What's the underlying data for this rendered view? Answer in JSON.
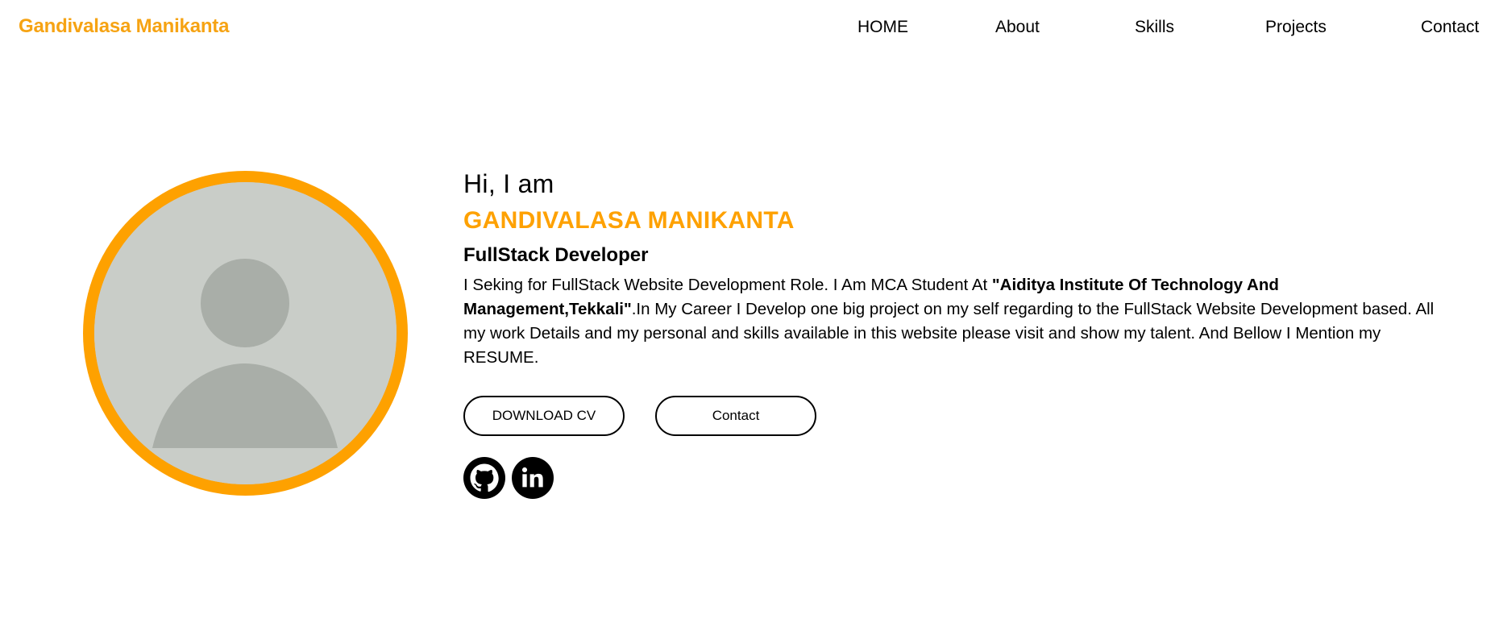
{
  "header": {
    "logo": "Gandivalasa Manikanta",
    "nav": [
      "HOME",
      "About",
      "Skills",
      "Projects",
      "Contact"
    ]
  },
  "hero": {
    "greeting": "Hi, I am",
    "name": "GANDIVALASA MANIKANTA",
    "role": "FullStack Developer",
    "bio_before": "I Seking for FullStack Website Development Role. I Am MCA Student At ",
    "bio_bold": "\"Aiditya Institute Of Technology And Management,Tekkali\"",
    "bio_after": ".In My Career I Develop one big project on my self regarding to the FullStack Website Development based. All my work Details and my personal and skills available in this website please visit and show my talent. And Bellow I Mention my RESUME.",
    "buttons": {
      "download": "DOWNLOAD CV",
      "contact": "Contact"
    },
    "socials": [
      "github-icon",
      "linkedin-icon"
    ]
  },
  "colors": {
    "accent": "#fea100",
    "logo": "#f6a313",
    "text": "#000000"
  }
}
